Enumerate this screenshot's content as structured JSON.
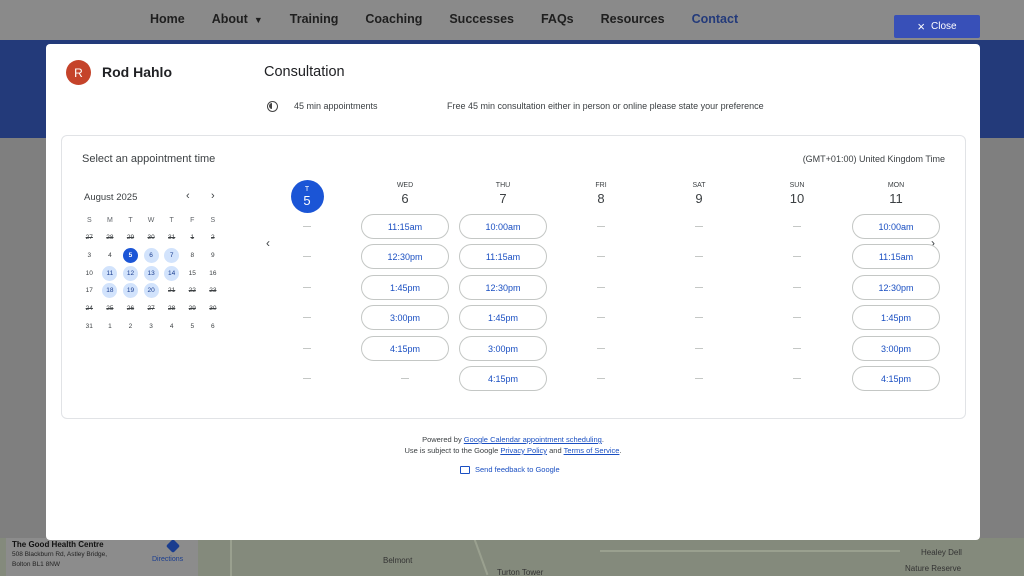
{
  "site_nav": {
    "items": [
      {
        "label": "Home"
      },
      {
        "label": "About"
      },
      {
        "label": "Training"
      },
      {
        "label": "Coaching"
      },
      {
        "label": "Successes"
      },
      {
        "label": "FAQs"
      },
      {
        "label": "Resources"
      },
      {
        "label": "Contact"
      }
    ],
    "active": "Contact"
  },
  "close_button": {
    "label": "Close"
  },
  "map": {
    "place_name": "The Good Health Centre",
    "address_line1": "508 Blackburn Rd, Astley Bridge,",
    "address_line2": "Bolton BL1 8NW",
    "directions_label": "Directions",
    "labels": [
      "Belmont",
      "Turton Tower",
      "Healey Dell",
      "Nature Reserve"
    ]
  },
  "booking": {
    "host": {
      "initial": "R",
      "name": "Rod Hahlo"
    },
    "title": "Consultation",
    "duration": "45 min appointments",
    "description": "Free 45 min consultation either in person or online please state your preference",
    "panel_title": "Select an appointment time",
    "timezone": "(GMT+01:00) United Kingdom Time",
    "mini_calendar": {
      "month_label": "August 2025",
      "prev_icon": "chevron-left-icon",
      "next_icon": "chevron-right-icon",
      "weekdays": [
        "S",
        "M",
        "T",
        "W",
        "T",
        "F",
        "S"
      ],
      "days": [
        {
          "d": "27",
          "state": "past"
        },
        {
          "d": "28",
          "state": "past"
        },
        {
          "d": "29",
          "state": "past"
        },
        {
          "d": "30",
          "state": "past"
        },
        {
          "d": "31",
          "state": "past"
        },
        {
          "d": "1",
          "state": "past"
        },
        {
          "d": "2",
          "state": "past"
        },
        {
          "d": "3",
          "state": "plain"
        },
        {
          "d": "4",
          "state": "plain"
        },
        {
          "d": "5",
          "state": "selected"
        },
        {
          "d": "6",
          "state": "available"
        },
        {
          "d": "7",
          "state": "available"
        },
        {
          "d": "8",
          "state": "plain"
        },
        {
          "d": "9",
          "state": "plain"
        },
        {
          "d": "10",
          "state": "plain"
        },
        {
          "d": "11",
          "state": "available"
        },
        {
          "d": "12",
          "state": "available"
        },
        {
          "d": "13",
          "state": "available"
        },
        {
          "d": "14",
          "state": "available"
        },
        {
          "d": "15",
          "state": "plain"
        },
        {
          "d": "16",
          "state": "plain"
        },
        {
          "d": "17",
          "state": "plain"
        },
        {
          "d": "18",
          "state": "available"
        },
        {
          "d": "19",
          "state": "available"
        },
        {
          "d": "20",
          "state": "available"
        },
        {
          "d": "21",
          "state": "past"
        },
        {
          "d": "22",
          "state": "past"
        },
        {
          "d": "23",
          "state": "past"
        },
        {
          "d": "24",
          "state": "past"
        },
        {
          "d": "25",
          "state": "past"
        },
        {
          "d": "26",
          "state": "past"
        },
        {
          "d": "27",
          "state": "past"
        },
        {
          "d": "28",
          "state": "past"
        },
        {
          "d": "29",
          "state": "past"
        },
        {
          "d": "30",
          "state": "past"
        },
        {
          "d": "31",
          "state": "plain"
        },
        {
          "d": "1",
          "state": "plain"
        },
        {
          "d": "2",
          "state": "plain"
        },
        {
          "d": "3",
          "state": "plain"
        },
        {
          "d": "4",
          "state": "plain"
        },
        {
          "d": "5",
          "state": "plain"
        },
        {
          "d": "6",
          "state": "plain"
        }
      ]
    },
    "week": [
      {
        "dow": "T",
        "day": "5",
        "today": true,
        "slots": []
      },
      {
        "dow": "WED",
        "day": "6",
        "slots": [
          "11:15am",
          "12:30pm",
          "1:45pm",
          "3:00pm",
          "4:15pm"
        ]
      },
      {
        "dow": "THU",
        "day": "7",
        "slots": [
          "10:00am",
          "11:15am",
          "12:30pm",
          "1:45pm",
          "3:00pm",
          "4:15pm"
        ]
      },
      {
        "dow": "FRI",
        "day": "8",
        "slots": []
      },
      {
        "dow": "SAT",
        "day": "9",
        "slots": []
      },
      {
        "dow": "SUN",
        "day": "10",
        "slots": []
      },
      {
        "dow": "MON",
        "day": "11",
        "slots": [
          "10:00am",
          "11:15am",
          "12:30pm",
          "1:45pm",
          "3:00pm",
          "4:15pm"
        ]
      }
    ],
    "footer": {
      "powered_prefix": "Powered by ",
      "powered_link": "Google Calendar appointment scheduling",
      "powered_suffix": ".",
      "terms_prefix": "Use is subject to the Google ",
      "privacy_link": "Privacy Policy",
      "terms_mid": " and ",
      "terms_link": "Terms of Service",
      "terms_suffix": ".",
      "feedback": "Send feedback to Google"
    }
  },
  "colors": {
    "brand_blue": "#1b55d6",
    "banner": "#233a7a",
    "close_button": "#3850b8",
    "avatar": "#c5432a",
    "available_day": "#d2e3fc"
  }
}
